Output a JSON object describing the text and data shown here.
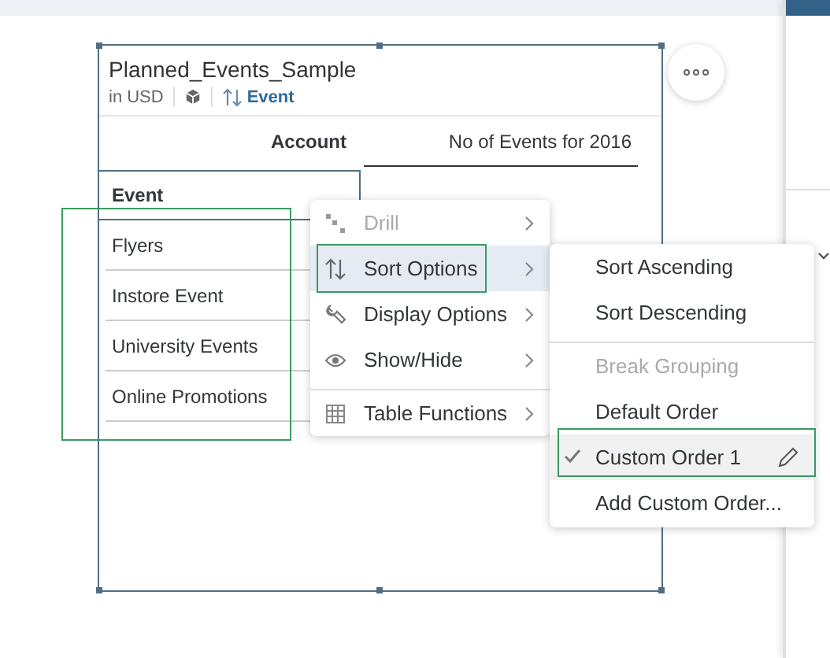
{
  "widget": {
    "title": "Planned_Events_Sample",
    "currency": "in USD",
    "sort_label": "Event",
    "table": {
      "row_header": "Account",
      "column_header": "No of Events for 2016",
      "dimension": "Event",
      "rows": [
        {
          "label": "Flyers"
        },
        {
          "label": "Instore Event"
        },
        {
          "label": "University Events"
        },
        {
          "label": "Online Promotions"
        }
      ]
    }
  },
  "context_menu": {
    "items": [
      {
        "label": "Drill",
        "disabled": true,
        "selected": false,
        "separator_before": false
      },
      {
        "label": "Sort Options",
        "disabled": false,
        "selected": true,
        "separator_before": false
      },
      {
        "label": "Display Options",
        "disabled": false,
        "selected": false,
        "separator_before": false
      },
      {
        "label": "Show/Hide",
        "disabled": false,
        "selected": false,
        "separator_before": false
      },
      {
        "label": "Table Functions",
        "disabled": false,
        "selected": false,
        "separator_before": true
      }
    ]
  },
  "submenu": {
    "items": [
      {
        "label": "Sort Ascending",
        "disabled": false,
        "checked": false,
        "editable": false,
        "separator_before": false
      },
      {
        "label": "Sort Descending",
        "disabled": false,
        "checked": false,
        "editable": false,
        "separator_before": false
      },
      {
        "label": "Break Grouping",
        "disabled": true,
        "checked": false,
        "editable": false,
        "separator_before": true
      },
      {
        "label": "Default Order",
        "disabled": false,
        "checked": false,
        "editable": false,
        "separator_before": false
      },
      {
        "label": "Custom Order 1",
        "disabled": false,
        "checked": true,
        "editable": true,
        "separator_before": false
      },
      {
        "label": "Add Custom Order...",
        "disabled": false,
        "checked": false,
        "editable": false,
        "separator_before": false
      }
    ]
  }
}
